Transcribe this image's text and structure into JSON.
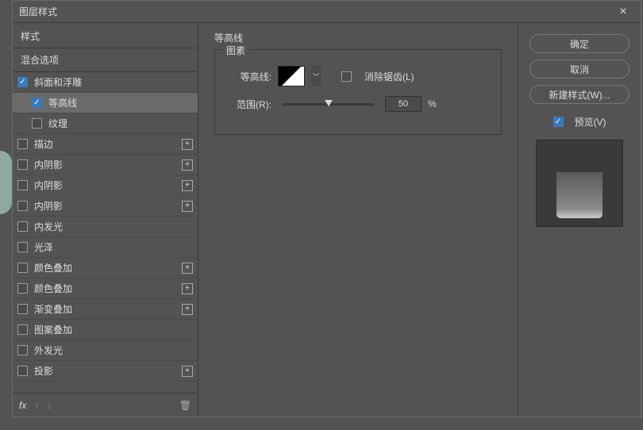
{
  "window": {
    "title": "图层样式"
  },
  "sidebar": {
    "header": "样式",
    "blend_options": "混合选项",
    "items": [
      {
        "label": "斜面和浮雕",
        "checked": true,
        "add": false,
        "indent": false
      },
      {
        "label": "等高线",
        "checked": true,
        "add": false,
        "indent": true,
        "selected": true
      },
      {
        "label": "纹理",
        "checked": false,
        "add": false,
        "indent": true
      },
      {
        "label": "描边",
        "checked": false,
        "add": true,
        "indent": false
      },
      {
        "label": "内阴影",
        "checked": false,
        "add": true,
        "indent": false
      },
      {
        "label": "内阴影",
        "checked": false,
        "add": true,
        "indent": false
      },
      {
        "label": "内阴影",
        "checked": false,
        "add": true,
        "indent": false
      },
      {
        "label": "内发光",
        "checked": false,
        "add": false,
        "indent": false
      },
      {
        "label": "光泽",
        "checked": false,
        "add": false,
        "indent": false
      },
      {
        "label": "颜色叠加",
        "checked": false,
        "add": true,
        "indent": false
      },
      {
        "label": "颜色叠加",
        "checked": false,
        "add": true,
        "indent": false
      },
      {
        "label": "渐变叠加",
        "checked": false,
        "add": true,
        "indent": false
      },
      {
        "label": "图案叠加",
        "checked": false,
        "add": false,
        "indent": false
      },
      {
        "label": "外发光",
        "checked": false,
        "add": false,
        "indent": false
      },
      {
        "label": "投影",
        "checked": false,
        "add": true,
        "indent": false
      }
    ],
    "footer_fx": "fx"
  },
  "panel": {
    "title": "等高线",
    "group": "图素",
    "contour_label": "等高线:",
    "antialias_label": "消除锯齿(L)",
    "range_label": "范围(R):",
    "range_value": "50",
    "range_unit": "%"
  },
  "buttons": {
    "ok": "确定",
    "cancel": "取消",
    "new_style": "新建样式(W)...",
    "preview": "预览(V)"
  }
}
